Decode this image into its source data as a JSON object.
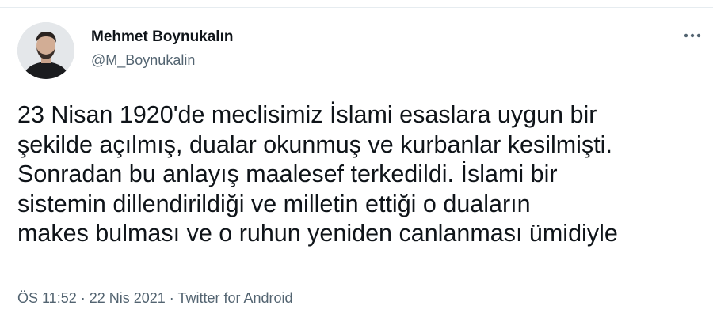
{
  "author": {
    "display_name": "Mehmet Boynukalın",
    "handle": "@M_Boynukalin"
  },
  "more_menu": {
    "icon": "more-horizontal-icon"
  },
  "tweet": {
    "lines": [
      "23 Nisan 1920'de meclisimiz İslami esaslara uygun bir",
      "şekilde açılmış, dualar okunmuş ve kurbanlar kesilmişti.",
      "Sonradan bu anlayış maalesef terkedildi. İslami bir",
      "sistemin dillendirildiği ve milletin ettiği o duaların",
      "makes bulması ve o ruhun yeniden canlanması ümidiyle"
    ]
  },
  "meta": {
    "time": "ÖS 11:52",
    "separator": " · ",
    "date": "22 Nis 2021",
    "source": "Twitter for Android"
  },
  "colors": {
    "text": "#0f1419",
    "secondary": "#536471",
    "divider": "#e6ecf0"
  }
}
